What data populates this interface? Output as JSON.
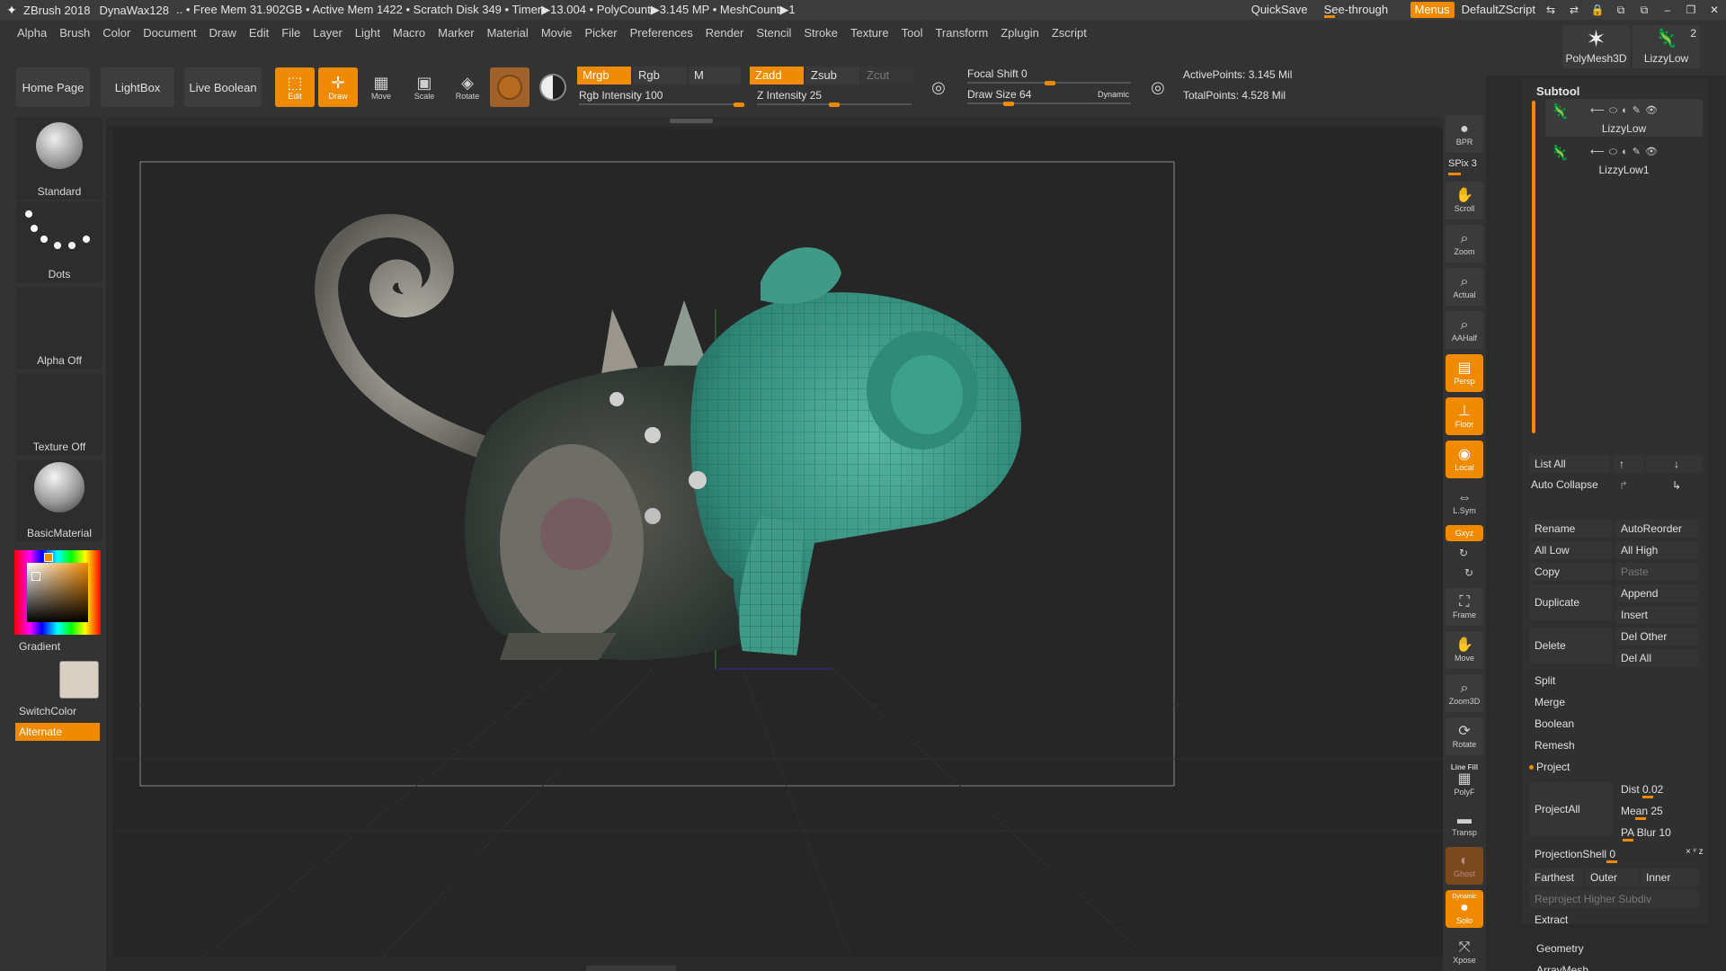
{
  "titlebar": {
    "app": "ZBrush 2018",
    "document": "DynaWax128",
    "info": ".. • Free Mem 31.902GB • Active Mem 1422 • Scratch Disk 349 •  Timer▶13.004 • PolyCount▶3.145 MP  • MeshCount▶1",
    "quicksave": "QuickSave",
    "seethrough_label": "See-through",
    "seethrough_value": "0",
    "menus": "Menus",
    "script": "DefaultZScript"
  },
  "menubar": [
    "Alpha",
    "Brush",
    "Color",
    "Document",
    "Draw",
    "Edit",
    "File",
    "Layer",
    "Light",
    "Macro",
    "Marker",
    "Material",
    "Movie",
    "Picker",
    "Preferences",
    "Render",
    "Stencil",
    "Stroke",
    "Texture",
    "Tool",
    "Transform",
    "Zplugin",
    "Zscript"
  ],
  "toolbar": {
    "home_page": "Home Page",
    "lightbox": "LightBox",
    "live_boolean": "Live Boolean",
    "edit": "Edit",
    "draw": "Draw",
    "move": "Move",
    "scale": "Scale",
    "rotate": "Rotate",
    "mrgb": "Mrgb",
    "rgb": "Rgb",
    "m": "M",
    "rgb_intensity_label": "Rgb Intensity",
    "rgb_intensity_value": "100",
    "zadd": "Zadd",
    "zsub": "Zsub",
    "zcut": "Zcut",
    "z_intensity_label": "Z Intensity",
    "z_intensity_value": "25",
    "focal_shift_label": "Focal Shift",
    "focal_shift_value": "0",
    "draw_size_label": "Draw Size",
    "draw_size_value": "64",
    "dynamic": "Dynamic",
    "active_points": "ActivePoints: 3.145 Mil",
    "total_points": "TotalPoints: 4.528 Mil"
  },
  "leftshelf": {
    "brush": "Standard",
    "stroke": "Dots",
    "alpha": "Alpha Off",
    "texture": "Texture Off",
    "material": "BasicMaterial",
    "gradient": "Gradient",
    "switchcolor": "SwitchColor",
    "alternate": "Alternate"
  },
  "rightcol": {
    "bpr": "BPR",
    "spix_label": "SPix",
    "spix_value": "3",
    "scroll": "Scroll",
    "zoom": "Zoom",
    "actual": "Actual",
    "aahalf": "AAHalf",
    "persp": "Persp",
    "floor": "Floor",
    "local": "Local",
    "lsym": "L.Sym",
    "xyz": "Gxyz",
    "frame": "Frame",
    "move": "Move",
    "zoom3d": "Zoom3D",
    "rotate": "Rotate",
    "line_fill": "Line Fill",
    "polyf": "PolyF",
    "transp": "Transp",
    "ghost": "Ghost",
    "dynamic": "Dynamic",
    "solo": "Solo",
    "xpose": "Xpose"
  },
  "rightpanel": {
    "tile1": "PolyMesh3D",
    "tile2": "LizzyLow",
    "tile2_count": "2",
    "subtool_title": "Subtool",
    "subtools": [
      "LizzyLow",
      "LizzyLow1"
    ],
    "list_all": "List All",
    "auto_collapse": "Auto Collapse",
    "rename": "Rename",
    "autoreorder": "AutoReorder",
    "all_low": "All Low",
    "all_high": "All High",
    "copy": "Copy",
    "paste": "Paste",
    "duplicate": "Duplicate",
    "append": "Append",
    "insert": "Insert",
    "delete": "Delete",
    "del_other": "Del Other",
    "del_all": "Del All",
    "split": "Split",
    "merge": "Merge",
    "boolean": "Boolean",
    "remesh": "Remesh",
    "project": "Project",
    "projectall": "ProjectAll",
    "dist": "Dist 0.02",
    "mean": "Mean 25",
    "pa_blur": "PA Blur 10",
    "projection_shell": "ProjectionShell 0",
    "xyz_small": "× ᵛ z",
    "farthest": "Farthest",
    "outer": "Outer",
    "inner": "Inner",
    "reproject": "Reproject Higher Subdiv",
    "extract": "Extract",
    "geometry": "Geometry",
    "array_mesh": "ArrayMesh"
  },
  "colors": {
    "accent": "#f08a00",
    "background": "#2a2a2a",
    "model": "#3f9b87"
  }
}
